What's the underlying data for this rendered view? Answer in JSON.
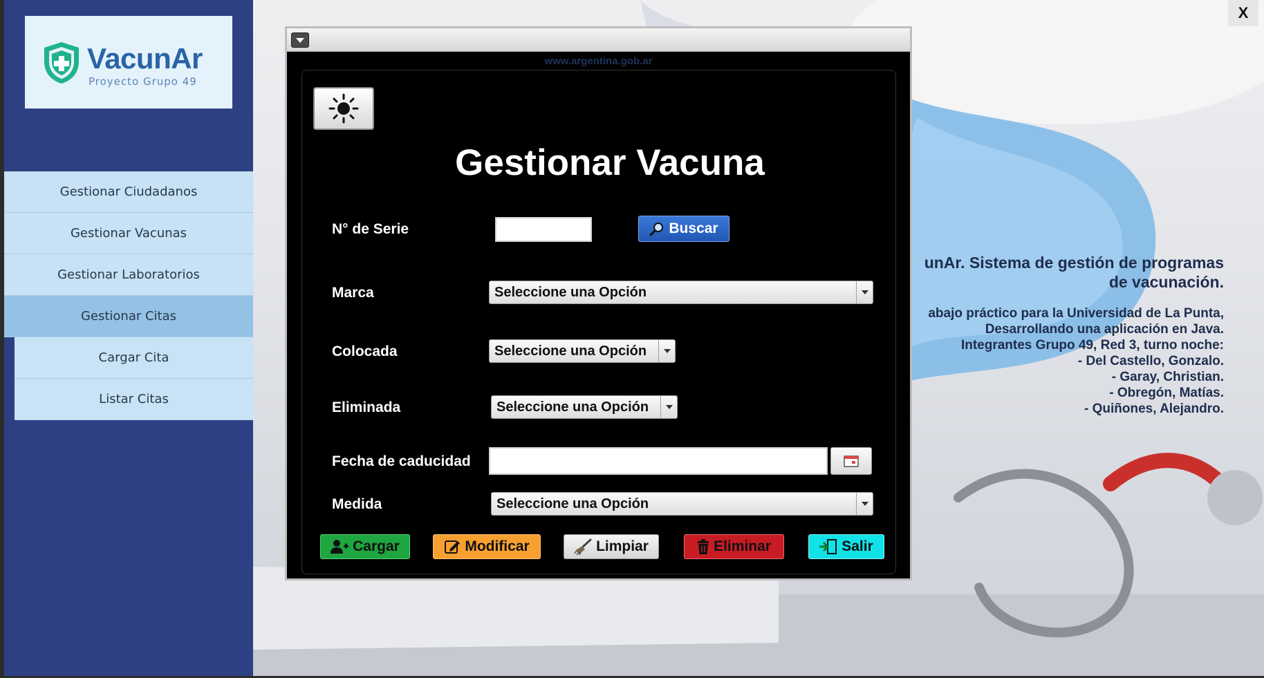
{
  "app": {
    "close_label": "X"
  },
  "brand": {
    "title": "VacunAr",
    "subtitle": "Proyecto Grupo 49",
    "colors": {
      "primary": "#2a64a6",
      "shield": "#1fb38c",
      "sidebar": "#2e4084"
    }
  },
  "sidebar": {
    "items": [
      {
        "label": "Gestionar Ciudadanos",
        "active": false,
        "sub": false
      },
      {
        "label": "Gestionar Vacunas",
        "active": false,
        "sub": false
      },
      {
        "label": "Gestionar Laboratorios",
        "active": false,
        "sub": false
      },
      {
        "label": "Gestionar Citas",
        "active": true,
        "sub": false
      },
      {
        "label": "Cargar Cita",
        "active": false,
        "sub": true
      },
      {
        "label": "Listar Citas",
        "active": false,
        "sub": true
      }
    ]
  },
  "info": {
    "title_line1": "unAr. Sistema de gestión de programas",
    "title_line2": "de vacunación.",
    "lines": [
      "abajo práctico para la Universidad de La Punta,",
      "Desarrollando una aplicación en Java.",
      "Integrantes Grupo 49, Red 3, turno noche:",
      "- Del Castello, Gonzalo.",
      "- Garay, Christian.",
      "- Obregón, Matías.",
      "- Quiñones, Alejandro."
    ]
  },
  "window": {
    "url": "www.argentina.gob.ar",
    "title": "Gestionar Vacuna",
    "theme_icon": "sun-icon",
    "fields": {
      "serie": {
        "label": "N° de Serie",
        "value": ""
      },
      "marca": {
        "label": "Marca",
        "value": "Seleccione una Opción"
      },
      "colocada": {
        "label": "Colocada",
        "value": "Seleccione una Opción"
      },
      "eliminada": {
        "label": "Eliminada",
        "value": "Seleccione una Opción"
      },
      "fecha": {
        "label": "Fecha de caducidad",
        "value": ""
      },
      "medida": {
        "label": "Medida",
        "value": "Seleccione una Opción"
      }
    },
    "buttons": {
      "buscar": "Buscar",
      "cargar": "Cargar",
      "modificar": "Modificar",
      "limpiar": "Limpiar",
      "eliminar": "Eliminar",
      "salir": "Salir"
    },
    "button_colors": {
      "buscar": "#2a63c5",
      "cargar": "#1ea640",
      "modificar": "#f7a030",
      "eliminar": "#c81c24",
      "salir": "#11e2e8"
    }
  }
}
